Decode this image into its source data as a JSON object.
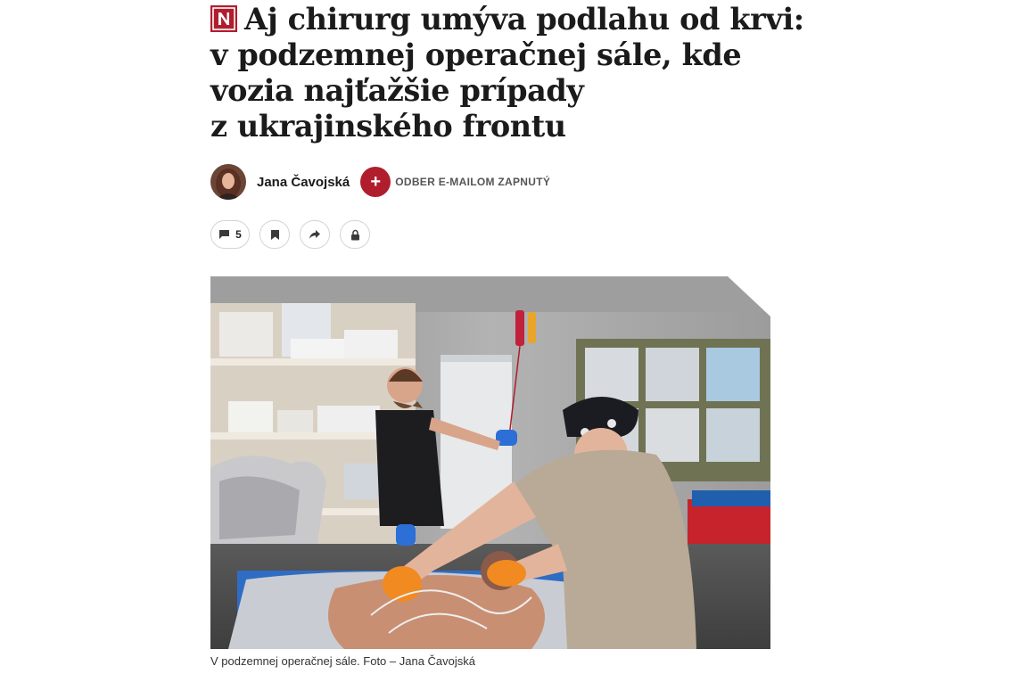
{
  "article": {
    "headline_lines": [
      "Aj chirurg umýva podlahu od krvi:",
      "v podzemnej operačnej sále, kde",
      "vozia najťažšie prípady",
      "z ukrajinského frontu"
    ],
    "brand_letter": "N",
    "brand_color": "#b01e2e"
  },
  "author": {
    "name": "Jana Čavojská",
    "subscribe_symbol": "+",
    "subscribe_label": "ODBER E-MAILOM ZAPNUTÝ"
  },
  "actions": {
    "comment_icon": "comment-icon",
    "comments_count": "5",
    "bookmark_icon": "bookmark-icon",
    "share_icon": "share-icon",
    "lock_icon": "lock-icon"
  },
  "photo": {
    "caption": "V podzemnej operačnej sále. Foto – Jana Čavojská"
  }
}
